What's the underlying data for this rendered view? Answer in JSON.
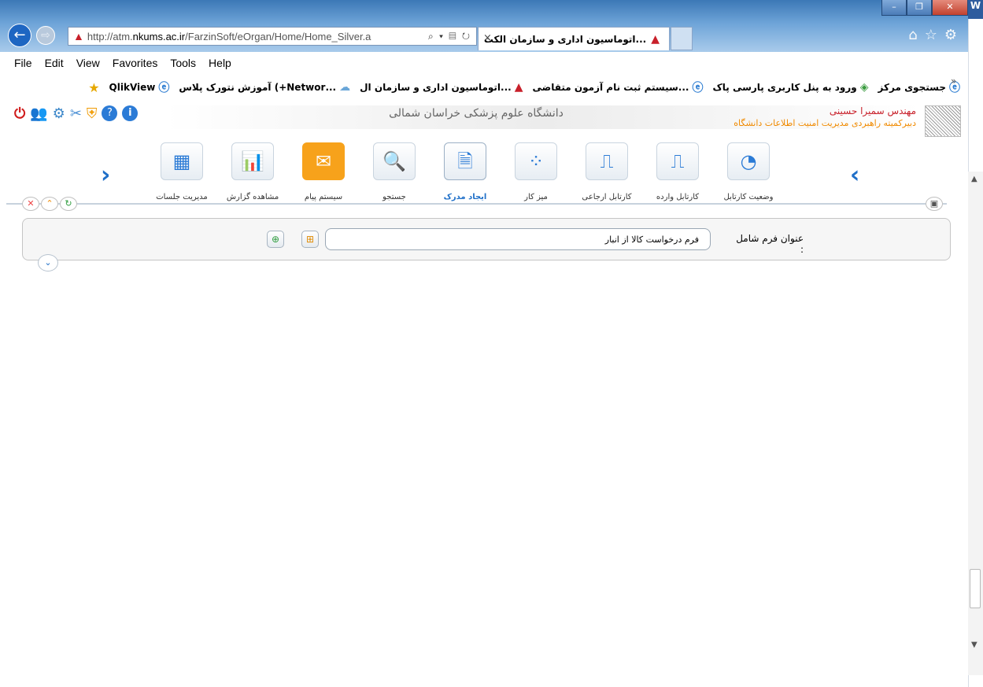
{
  "browser": {
    "url_prefix": "http://atm.",
    "url_host": "nkums.ac.ir",
    "url_path": "/FarzinSoft/eOrgan/Home/Home_Silver.a",
    "addr_tools": "⌕ ▾ ▤ ↻",
    "tab_title": "...اتوماسیون اداری و سازمان الکت",
    "tab_close": "×"
  },
  "menu": [
    "File",
    "Edit",
    "View",
    "Favorites",
    "Tools",
    "Help"
  ],
  "favorites": [
    {
      "label": "جستجوی مرکز",
      "icon": "ie"
    },
    {
      "label": "ورود به پنل کاربری پارسی پاک",
      "icon": "green"
    },
    {
      "label": "...سیستم ثبت نام آزمون متقاضی",
      "icon": "ie"
    },
    {
      "label": "...اتوماسیون اداری و سازمان ال",
      "icon": "red"
    },
    {
      "label": "...Networ+) آموزش نتورک پلاس",
      "icon": "net"
    },
    {
      "label": "QlikView",
      "icon": "ie"
    }
  ],
  "app": {
    "university_title": "دانشگاه علوم پزشکی خراسان شمالی",
    "user_name": "مهندس سمیرا حسینی",
    "user_role": "دبیرکمیته راهبردی مدیریت امنیت اطلاعات دانشگاه"
  },
  "modules": [
    {
      "label": "مدیریت جلسات",
      "icon": "calendar-icon"
    },
    {
      "label": "مشاهده گزارش",
      "icon": "report-icon"
    },
    {
      "label": "سیستم پیام",
      "icon": "mail-icon"
    },
    {
      "label": "جستجو",
      "icon": "search-icon"
    },
    {
      "label": "ایجاد مدرک",
      "icon": "create-document-icon",
      "active": true
    },
    {
      "label": "میز کار",
      "icon": "desk-icon"
    },
    {
      "label": "کارتابل ارجاعی",
      "icon": "referral-inbox-icon"
    },
    {
      "label": "کارتابل وارده",
      "icon": "incoming-inbox-icon"
    },
    {
      "label": "وضعیت کارتابل",
      "icon": "inbox-status-icon"
    }
  ],
  "filter": {
    "label": "عنوان فرم شامل :",
    "value": "فرم درخواست کالا از انبار"
  },
  "colors": {
    "accent": "#1f6fc8",
    "user_name": "#c8202a",
    "user_role": "#f08a00"
  }
}
